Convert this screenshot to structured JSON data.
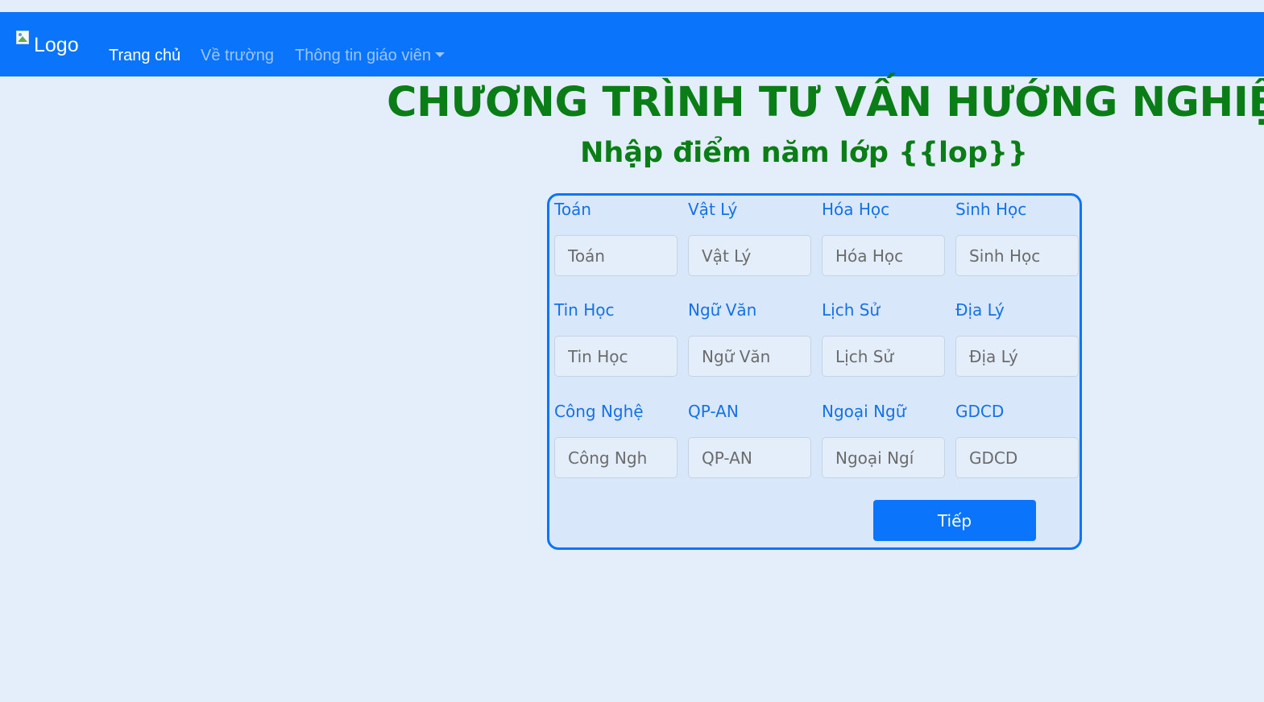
{
  "nav": {
    "logo_alt": "Logo",
    "links": [
      {
        "label": "Trang chủ",
        "active": true
      },
      {
        "label": "Về trường",
        "active": false
      },
      {
        "label": "Thông tin giáo viên",
        "active": false,
        "dropdown": true
      }
    ]
  },
  "header": {
    "title": "CHƯƠNG TRÌNH TƯ VẤN HƯỚNG NGHIỆP",
    "subtitle": "Nhập điểm năm lớp {{lop}}"
  },
  "form": {
    "fields": [
      {
        "label": "Toán",
        "placeholder": "Toán"
      },
      {
        "label": "Vật Lý",
        "placeholder": "Vật Lý"
      },
      {
        "label": "Hóa Học",
        "placeholder": "Hóa Học"
      },
      {
        "label": "Sinh Học",
        "placeholder": "Sinh Học"
      },
      {
        "label": "Tin Học",
        "placeholder": "Tin Học"
      },
      {
        "label": "Ngữ Văn",
        "placeholder": "Ngữ Văn"
      },
      {
        "label": "Lịch Sử",
        "placeholder": "Lịch Sử"
      },
      {
        "label": "Địa Lý",
        "placeholder": "Địa Lý"
      },
      {
        "label": "Công Nghệ",
        "placeholder": "Công Ngh"
      },
      {
        "label": "QP-AN",
        "placeholder": "QP-AN"
      },
      {
        "label": "Ngoại Ngữ",
        "placeholder": "Ngoại Ngí"
      },
      {
        "label": "GDCD",
        "placeholder": "GDCD"
      }
    ],
    "submit_label": "Tiếp"
  },
  "colors": {
    "navbar": "#0a74fb",
    "title": "#0a7d16",
    "label": "#1471e6",
    "background": "#e4eefb"
  }
}
